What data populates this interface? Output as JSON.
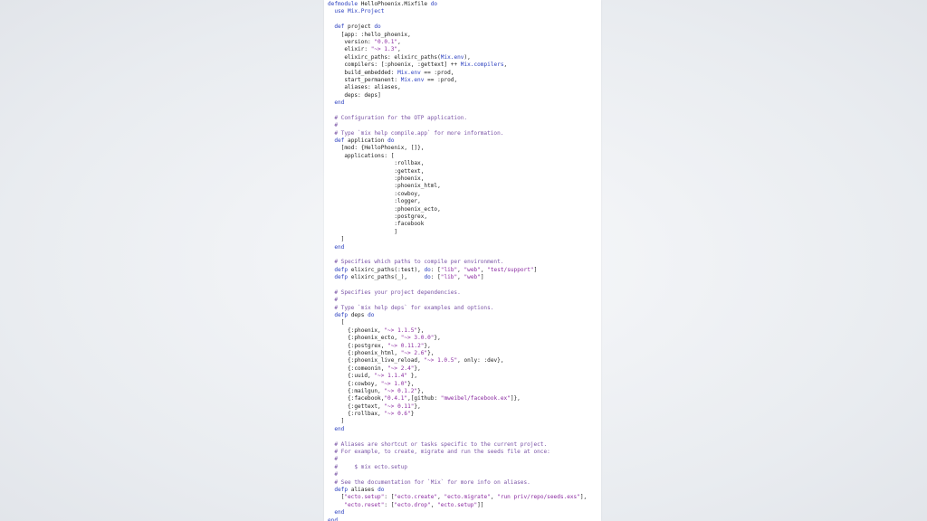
{
  "colors": {
    "keyword": "#2b3fbf",
    "comment": "#7a54a6",
    "string": "#8a2aa0",
    "default": "#222222",
    "background": "#eef0f3",
    "panel": "#ffffff"
  },
  "code": [
    "defmodule HelloPhoenix.Mixfile do",
    "  use Mix.Project",
    "",
    "  def project do",
    "    [app: :hello_phoenix,",
    "     version: \"0.0.1\",",
    "     elixir: \"~> 1.3\",",
    "     elixirc_paths: elixirc_paths(Mix.env),",
    "     compilers: [:phoenix, :gettext] ++ Mix.compilers,",
    "     build_embedded: Mix.env == :prod,",
    "     start_permanent: Mix.env == :prod,",
    "     aliases: aliases,",
    "     deps: deps]",
    "  end",
    "",
    "  # Configuration for the OTP application.",
    "  #",
    "  # Type `mix help compile.app` for more information.",
    "  def application do",
    "    [mod: {HelloPhoenix, []},",
    "     applications: [",
    "                    :rollbax,",
    "                    :gettext,",
    "                    :phoenix,",
    "                    :phoenix_html,",
    "                    :cowboy,",
    "                    :logger,",
    "                    :phoenix_ecto,",
    "                    :postgrex,",
    "                    :facebook",
    "                    ]",
    "    ]",
    "  end",
    "",
    "  # Specifies which paths to compile per environment.",
    "  defp elixirc_paths(:test), do: [\"lib\", \"web\", \"test/support\"]",
    "  defp elixirc_paths(_),     do: [\"lib\", \"web\"]",
    "",
    "  # Specifies your project dependencies.",
    "  #",
    "  # Type `mix help deps` for examples and options.",
    "  defp deps do",
    "    [",
    "      {:phoenix, \"~> 1.1.5\"},",
    "      {:phoenix_ecto, \"~> 3.0.0\"},",
    "      {:postgrex, \"~> 0.11.2\"},",
    "      {:phoenix_html, \"~> 2.6\"},",
    "      {:phoenix_live_reload, \"~> 1.0.5\", only: :dev},",
    "      {:comeonin, \"~> 2.4\"},",
    "      {:uuid, \"~> 1.1.4\" },",
    "      {:cowboy, \"~> 1.0\"},",
    "      {:mailgun, \"~> 0.1.2\"},",
    "      {:facebook,\"0.4.1\",[github: \"mweibel/facebook.ex\"]},",
    "      {:gettext, \"~> 0.11\"},",
    "      {:rollbax, \"~> 0.6\"}",
    "    ]",
    "  end",
    "",
    "  # Aliases are shortcut or tasks specific to the current project.",
    "  # For example, to create, migrate and run the seeds file at once:",
    "  #",
    "  #     $ mix ecto.setup",
    "  #",
    "  # See the documentation for `Mix` for more info on aliases.",
    "  defp aliases do",
    "    [\"ecto.setup\": [\"ecto.create\", \"ecto.migrate\", \"run priv/repo/seeds.exs\"],",
    "     \"ecto.reset\": [\"ecto.drop\", \"ecto.setup\"]]",
    "  end",
    "end"
  ]
}
